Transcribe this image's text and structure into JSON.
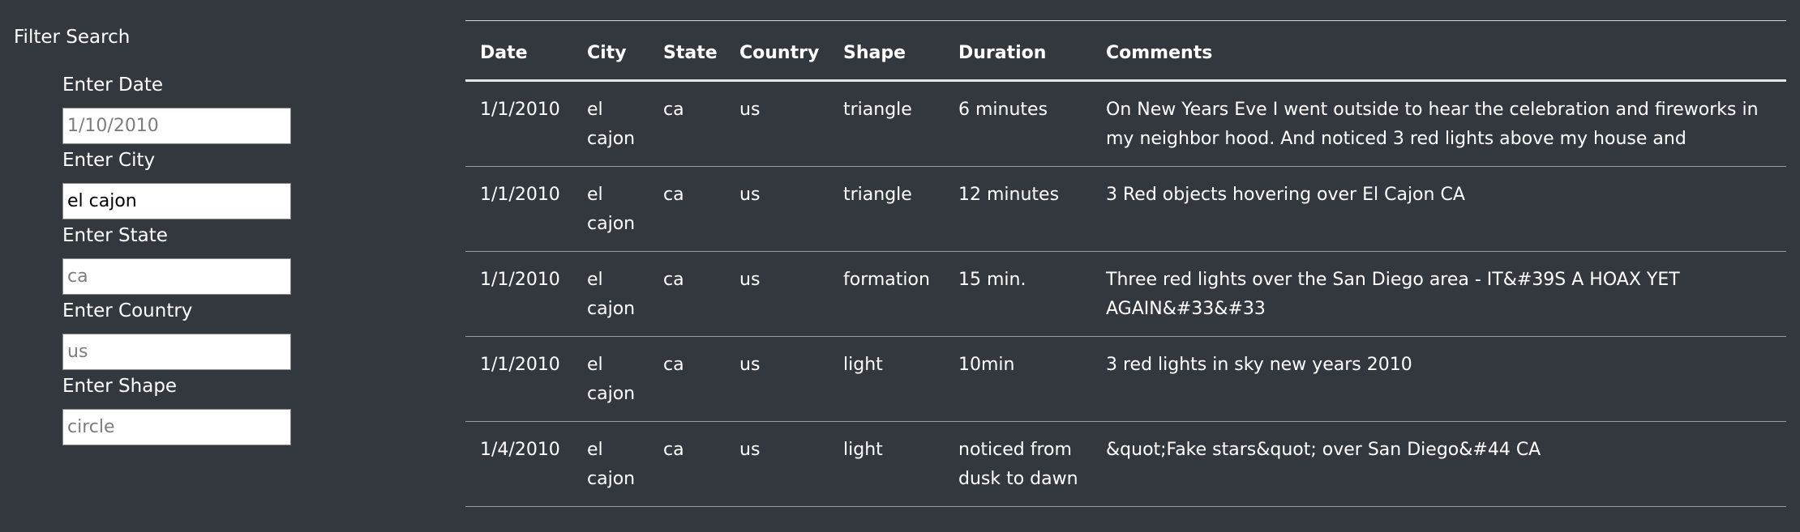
{
  "filter": {
    "title": "Filter Search",
    "fields": [
      {
        "label": "Enter Date",
        "value": "",
        "placeholder": "1/10/2010"
      },
      {
        "label": "Enter City",
        "value": "el cajon",
        "placeholder": ""
      },
      {
        "label": "Enter State",
        "value": "",
        "placeholder": "ca"
      },
      {
        "label": "Enter Country",
        "value": "",
        "placeholder": "us"
      },
      {
        "label": "Enter Shape",
        "value": "",
        "placeholder": "circle"
      }
    ]
  },
  "table": {
    "headers": [
      "Date",
      "City",
      "State",
      "Country",
      "Shape",
      "Duration",
      "Comments"
    ],
    "rows": [
      [
        "1/1/2010",
        "el cajon",
        "ca",
        "us",
        "triangle",
        "6 minutes",
        "On New Years Eve I went outside to hear the celebration and fireworks in my neighbor hood. And noticed 3 red lights above my house and"
      ],
      [
        "1/1/2010",
        "el cajon",
        "ca",
        "us",
        "triangle",
        "12 minutes",
        "3 Red objects hovering over El Cajon CA"
      ],
      [
        "1/1/2010",
        "el cajon",
        "ca",
        "us",
        "formation",
        "15 min.",
        "Three red lights over the San Diego area - IT&#39S A HOAX YET AGAIN&#33&#33"
      ],
      [
        "1/1/2010",
        "el cajon",
        "ca",
        "us",
        "light",
        "10min",
        "3 red lights in sky new years 2010"
      ],
      [
        "1/4/2010",
        "el cajon",
        "ca",
        "us",
        "light",
        "noticed from dusk to dawn",
        "&quot;Fake stars&quot; over San Diego&#44 CA"
      ]
    ]
  },
  "colors": {
    "background": "#33373e",
    "text": "#ffffff",
    "input_background": "#ffffff"
  }
}
